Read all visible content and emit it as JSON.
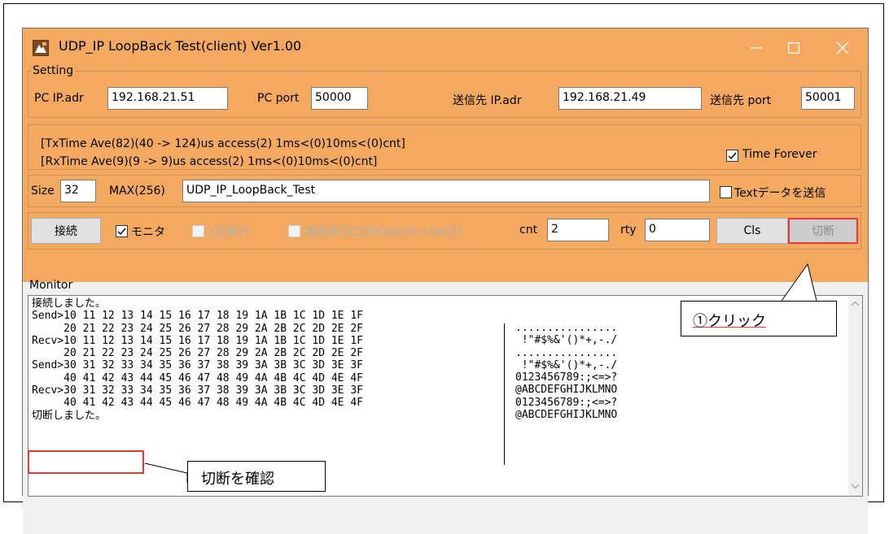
{
  "window": {
    "title": "UDP_IP LoopBack Test(client) Ver1.00"
  },
  "setting": {
    "group_label": "Setting",
    "pc_ip_label": "PC IP.adr",
    "pc_ip_value": "192.168.21.51",
    "pc_port_label": "PC port",
    "pc_port_value": "50000",
    "dest_ip_label": "送信先 IP.adr",
    "dest_ip_value": "192.168.21.49",
    "dest_port_label": "送信先 port",
    "dest_port_value": "50001"
  },
  "timing": {
    "tx_line": "[TxTime Ave(82)(40 -> 124)us access(2) 1ms<(0)10ms<(0)cnt]",
    "rx_line": "[RxTime Ave(9)(9 -> 9)us access(2) 1ms<(0)10ms<(0)cnt]",
    "time_forever_label": "Time Forever",
    "time_forever_checked": true
  },
  "payload": {
    "size_label": "Size",
    "size_value": "32",
    "max_label": "MAX(256)",
    "text_value": "UDP_IP_LoopBack_Test",
    "text_send_label": "Textデータを送信",
    "text_send_checked": false
  },
  "controls": {
    "connect_label": "接続",
    "monitor_label": "モニタ",
    "monitor_checked": true,
    "once_label": "1回実行",
    "continuous_label": "連続実行CODE(0x10->0xCF)",
    "cnt_label": "cnt",
    "cnt_value": "2",
    "rty_label": "rty",
    "rty_value": "0",
    "cls_label": "Cls",
    "disconnect_label": "切断"
  },
  "monitor": {
    "label": "Monitor",
    "lines": [
      "接続しました。",
      "Send>10 11 12 13 14 15 16 17 18 19 1A 1B 1C 1D 1E 1F",
      "     20 21 22 23 24 25 26 27 28 29 2A 2B 2C 2D 2E 2F",
      "Recv>10 11 12 13 14 15 16 17 18 19 1A 1B 1C 1D 1E 1F",
      "     20 21 22 23 24 25 26 27 28 29 2A 2B 2C 2D 2E 2F",
      "Send>30 31 32 33 34 35 36 37 38 39 3A 3B 3C 3D 3E 3F",
      "     40 41 42 43 44 45 46 47 48 49 4A 4B 4C 4D 4E 4F",
      "Recv>30 31 32 33 34 35 36 37 38 39 3A 3B 3C 3D 3E 3F",
      "     40 41 42 43 44 45 46 47 48 49 4A 4B 4C 4D 4E 4F",
      "切断しました。"
    ],
    "ascii": [
      "................",
      " !\"#$%&'()*+,-./",
      "................",
      " !\"#$%&'()*+,-./",
      "0123456789:;<=>?",
      "@ABCDEFGHIJKLMNO",
      "0123456789:;<=>?",
      "@ABCDEFGHIJKLMNO"
    ]
  },
  "annotations": {
    "click_callout": "①クリック",
    "confirm_callout": "切断を確認"
  },
  "colors": {
    "window_bg": "#f4a960",
    "highlight": "#e53935"
  }
}
